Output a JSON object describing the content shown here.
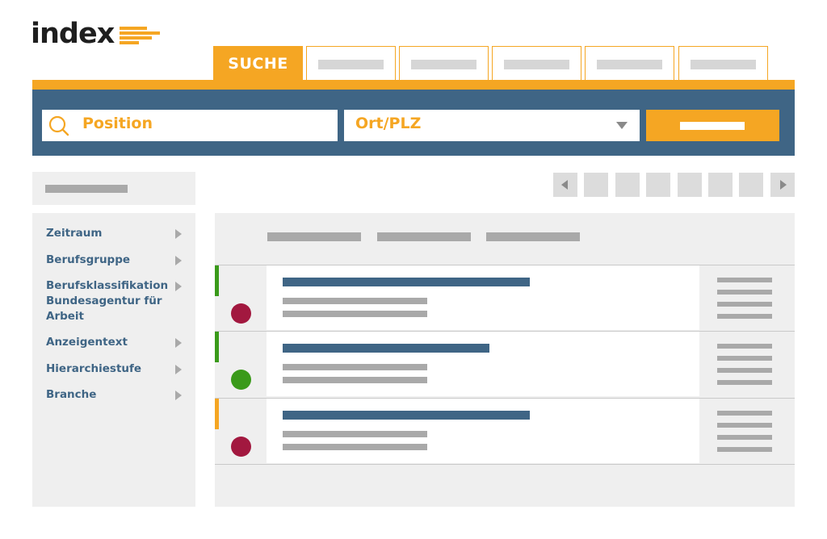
{
  "brand": {
    "logo_text": "index",
    "accent_color": "#f5a623",
    "navy_color": "#3f6585"
  },
  "tabs": [
    {
      "label": "SUCHE",
      "active": true
    },
    {
      "label": "",
      "active": false
    },
    {
      "label": "",
      "active": false
    },
    {
      "label": "",
      "active": false
    },
    {
      "label": "",
      "active": false
    },
    {
      "label": "",
      "active": false
    }
  ],
  "search": {
    "position_label": "Position",
    "location_label": "Ort/PLZ",
    "submit_label": ""
  },
  "sidebar": {
    "filters": [
      {
        "label": "Zeitraum"
      },
      {
        "label": "Berufsgruppe"
      },
      {
        "label": "Berufsklassifikation Bundesagentur für Arbeit"
      },
      {
        "label": "Anzeigentext"
      },
      {
        "label": "Hierarchiestufe"
      },
      {
        "label": "Branche"
      }
    ]
  },
  "results": [
    {
      "status_color": "#a2183f",
      "accent_color": "#3a9a1a"
    },
    {
      "status_color": "#3a9a1a",
      "accent_color": "#3a9a1a"
    },
    {
      "status_color": "#a2183f",
      "accent_color": "#f5a623"
    }
  ]
}
